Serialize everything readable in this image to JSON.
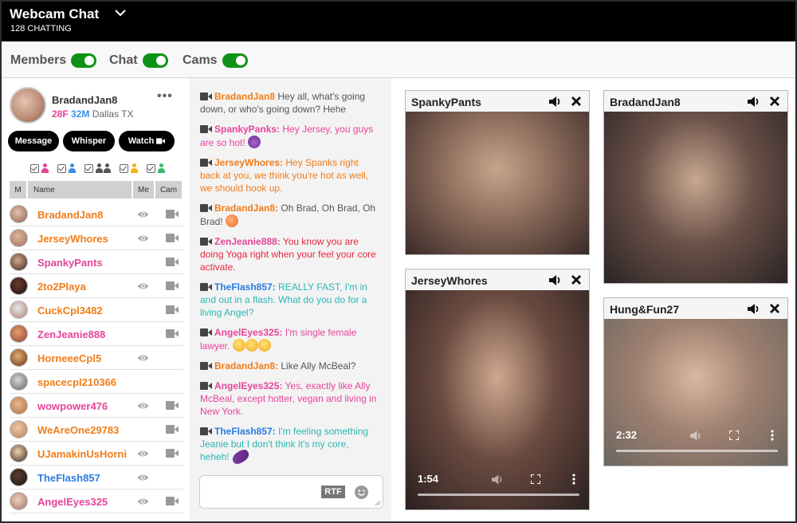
{
  "header": {
    "title": "Webcam Chat",
    "subtitle": "128 CHATTING",
    "dropdown_icon": "chevron-down-icon"
  },
  "toggles": [
    {
      "label": "Members",
      "on": true
    },
    {
      "label": "Chat",
      "on": true
    },
    {
      "label": "Cams",
      "on": true
    }
  ],
  "colors": {
    "toggle_on": "#109218",
    "female": "#e6449a",
    "male": "#3d8fe6",
    "couple_orange": "#f07d1a",
    "flash_blue": "#2a7be4",
    "teal": "#2ab7b4",
    "red": "#e8253c"
  },
  "profile": {
    "name": "BradandJan8",
    "age_f": "28F",
    "age_m": "32M",
    "location": "Dallas TX",
    "more_icon": "more-horizontal-icon",
    "buttons": [
      "Message",
      "Whisper",
      "Watch"
    ]
  },
  "filters": [
    {
      "icon": "female-icon",
      "checked": true,
      "color": "#e6449a"
    },
    {
      "icon": "male-icon",
      "checked": true,
      "color": "#3d8fe6"
    },
    {
      "icon": "couple-icon",
      "checked": true,
      "color": "#555555"
    },
    {
      "icon": "trans-icon",
      "checked": true,
      "color": "#f0b418"
    },
    {
      "icon": "group-icon",
      "checked": true,
      "color": "#3cb86a"
    }
  ],
  "table_headers": {
    "m": "M",
    "name": "Name",
    "me": "Me",
    "cam": "Cam"
  },
  "members": [
    {
      "name": "BradandJan8",
      "color": "#f07d1a",
      "watching": true,
      "cam": true
    },
    {
      "name": "JerseyWhores",
      "color": "#f07d1a",
      "watching": true,
      "cam": true
    },
    {
      "name": "SpankyPants",
      "color": "#e6449a",
      "watching": false,
      "cam": true
    },
    {
      "name": "2to2Playa",
      "color": "#f07d1a",
      "watching": true,
      "cam": true
    },
    {
      "name": "CuckCpl3482",
      "color": "#f07d1a",
      "watching": false,
      "cam": true
    },
    {
      "name": "ZenJeanie888",
      "color": "#e6449a",
      "watching": false,
      "cam": true
    },
    {
      "name": "HorneeeCpl5",
      "color": "#f07d1a",
      "watching": true,
      "cam": false
    },
    {
      "name": "spacecpl210366",
      "color": "#f07d1a",
      "watching": false,
      "cam": false
    },
    {
      "name": "wowpower476",
      "color": "#e6449a",
      "watching": true,
      "cam": true
    },
    {
      "name": "WeAreOne29783",
      "color": "#f07d1a",
      "watching": false,
      "cam": true
    },
    {
      "name": "UJamakinUsHorni",
      "color": "#f07d1a",
      "watching": true,
      "cam": true
    },
    {
      "name": "TheFlash857",
      "color": "#2a7be4",
      "watching": true,
      "cam": false
    },
    {
      "name": "AngelEyes325",
      "color": "#e6449a",
      "watching": true,
      "cam": true
    }
  ],
  "messages": [
    {
      "user": "BradandJan8",
      "user_color": "#f07d1a",
      "text": "Hey all, what's going down, or who's going down? Hehe",
      "text_color": "#555555",
      "emoji": null
    },
    {
      "user": "SpankyPanks:",
      "user_color": "#e6449a",
      "text": "Hey Jersey, you guys are so hot!",
      "text_color": "#e6449a",
      "emoji": "devil"
    },
    {
      "user": "JerseyWhores:",
      "user_color": "#f07d1a",
      "text": "Hey Spanks right back at you, we think you're hot as well, we should hook up.",
      "text_color": "#f07d1a",
      "emoji": null
    },
    {
      "user": "BradandJan8:",
      "user_color": "#f07d1a",
      "text": " Oh Brad, Oh Brad, Oh Brad!",
      "text_color": "#555555",
      "emoji": "peach"
    },
    {
      "user": "ZenJeanie888:",
      "user_color": "#e6449a",
      "text": "You know you are doing Yoga right when your feel your core activate.",
      "text_color": "#e8253c",
      "emoji": null
    },
    {
      "user": "TheFlash857:",
      "user_color": "#2a7be4",
      "text": "REALLY FAST, I'm in and out in a flash. What do you do for a living Angel?",
      "text_color": "#2ab7b4",
      "emoji": null
    },
    {
      "user": "AngelEyes325:",
      "user_color": "#e6449a",
      "text": "I'm single female lawyer.",
      "text_color": "#e6449a",
      "emoji": "tongue3"
    },
    {
      "user": "BradandJan8:",
      "user_color": "#f07d1a",
      "text": "Like Ally McBeal?",
      "text_color": "#555555",
      "emoji": null
    },
    {
      "user": "AngelEyes325:",
      "user_color": "#e6449a",
      "text": "Yes, exactly like Ally McBeal, except hotter, vegan and living in New York.",
      "text_color": "#e6449a",
      "emoji": null
    },
    {
      "user": "TheFlash857:",
      "user_color": "#2a7be4",
      "text": "I'm feeling something Jeanie but I don't think it's my core, heheh!",
      "text_color": "#2ab7b4",
      "emoji": "eggplant"
    }
  ],
  "chat_input": {
    "value": "",
    "rtf_label": "RTF",
    "emoji_icon": "smiley-icon"
  },
  "cams": [
    {
      "title": "SpankyPants",
      "time": null
    },
    {
      "title": "BradandJan8",
      "time": null
    },
    {
      "title": "JerseyWhores",
      "time": "1:54"
    },
    {
      "title": "Hung&Fun27",
      "time": "2:32"
    }
  ]
}
